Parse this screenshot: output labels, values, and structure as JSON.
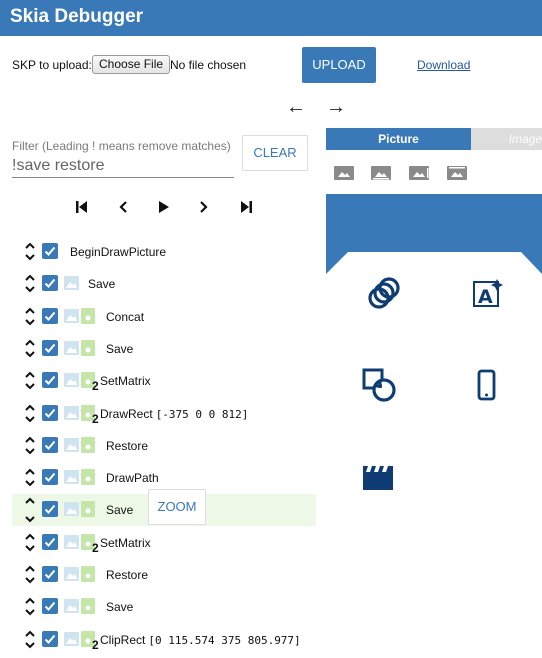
{
  "app": {
    "title": "Skia Debugger"
  },
  "upload": {
    "label": "SKP to upload:",
    "choose_button": "Choose File",
    "no_file": "No file chosen",
    "upload_button": "UPLOAD",
    "download_link": "Download"
  },
  "nav": {
    "back": "←",
    "forward": "→"
  },
  "filter": {
    "label": "Filter (Leading ! means remove matches)",
    "value": "!save restore",
    "clear_button": "CLEAR"
  },
  "playback": [
    "first",
    "previous",
    "play",
    "next",
    "last"
  ],
  "commands": [
    {
      "name": "BeginDrawPicture",
      "args": "",
      "img": false,
      "doc": false,
      "count": ""
    },
    {
      "name": "Save",
      "args": "",
      "img": true,
      "doc": false,
      "count": ""
    },
    {
      "name": "Concat",
      "args": "",
      "img": true,
      "doc": true,
      "count": ""
    },
    {
      "name": "Save",
      "args": "",
      "img": true,
      "doc": true,
      "count": ""
    },
    {
      "name": "SetMatrix",
      "args": "",
      "img": true,
      "doc": true,
      "count": "2"
    },
    {
      "name": "DrawRect",
      "args": "[-375 0 0 812]",
      "img": true,
      "doc": true,
      "count": "2"
    },
    {
      "name": "Restore",
      "args": "",
      "img": true,
      "doc": true,
      "count": ""
    },
    {
      "name": "DrawPath",
      "args": "",
      "img": true,
      "doc": true,
      "count": ""
    },
    {
      "name": "Save",
      "args": "",
      "img": true,
      "doc": true,
      "count": "",
      "selected": true,
      "zoom": "ZOOM"
    },
    {
      "name": "SetMatrix",
      "args": "",
      "img": true,
      "doc": true,
      "count": "2"
    },
    {
      "name": "Restore",
      "args": "",
      "img": true,
      "doc": true,
      "count": ""
    },
    {
      "name": "Save",
      "args": "",
      "img": true,
      "doc": true,
      "count": ""
    },
    {
      "name": "ClipRect",
      "args": "[0 115.574 375 805.977]",
      "img": true,
      "doc": true,
      "count": "2"
    }
  ],
  "tabs": {
    "picture": "Picture",
    "image": "Image"
  },
  "background_icons": [
    "image-icon",
    "image-icon",
    "image-icon",
    "image-icon"
  ],
  "canvas": {
    "accent": "#3a79b8",
    "tiles": [
      "circles-icon",
      "text-image-icon",
      "shapes-icon",
      "phone-icon",
      "film-icon"
    ]
  }
}
